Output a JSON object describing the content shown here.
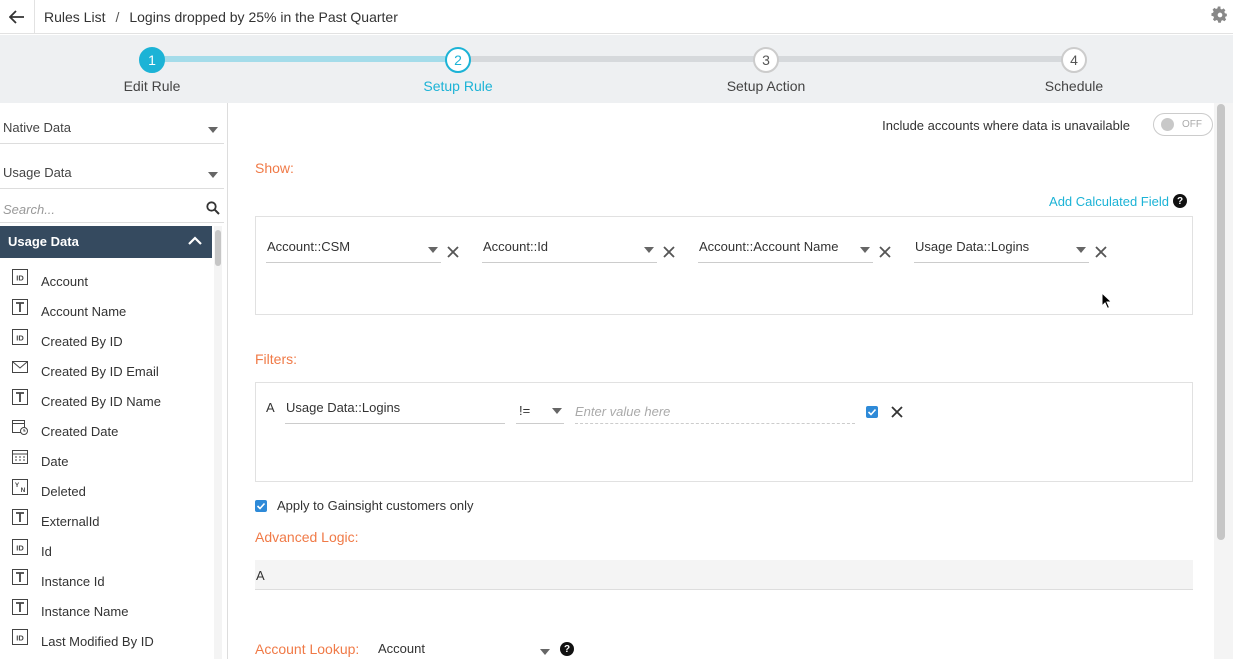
{
  "header": {
    "breadcrumb_root": "Rules List",
    "separator": "/",
    "title": "Logins dropped by 25% in the Past Quarter"
  },
  "stepper": {
    "steps": [
      {
        "number": "1",
        "label": "Edit Rule",
        "state": "done"
      },
      {
        "number": "2",
        "label": "Setup Rule",
        "state": "active"
      },
      {
        "number": "3",
        "label": "Setup Action",
        "state": "todo"
      },
      {
        "number": "4",
        "label": "Schedule",
        "state": "todo"
      }
    ]
  },
  "sidebar": {
    "source_select": "Native Data",
    "object_select": "Usage Data",
    "search_placeholder": "Search...",
    "group_title": "Usage Data",
    "fields": [
      {
        "icon": "id",
        "label": "Account"
      },
      {
        "icon": "text",
        "label": "Account Name"
      },
      {
        "icon": "id",
        "label": "Created By ID"
      },
      {
        "icon": "email",
        "label": "Created By ID Email"
      },
      {
        "icon": "text",
        "label": "Created By ID Name"
      },
      {
        "icon": "datetime",
        "label": "Created Date"
      },
      {
        "icon": "date",
        "label": "Date"
      },
      {
        "icon": "boolean",
        "label": "Deleted"
      },
      {
        "icon": "text",
        "label": "ExternalId"
      },
      {
        "icon": "id",
        "label": "Id"
      },
      {
        "icon": "text",
        "label": "Instance Id"
      },
      {
        "icon": "text",
        "label": "Instance Name"
      },
      {
        "icon": "id",
        "label": "Last Modified By ID"
      }
    ]
  },
  "main": {
    "include_label": "Include accounts where data is unavailable",
    "include_toggle": "OFF",
    "show_title": "Show:",
    "add_calculated_field": "Add Calculated Field",
    "help_glyph": "?",
    "show_columns": [
      "Account::CSM",
      "Account::Id",
      "Account::Account Name",
      "Usage Data::Logins"
    ],
    "filters_title": "Filters:",
    "filter": {
      "letter": "A",
      "field": "Usage Data::Logins",
      "operator": "!=",
      "value_placeholder": "Enter value here"
    },
    "apply_label": "Apply to Gainsight customers only",
    "advanced_logic_title": "Advanced Logic:",
    "advanced_logic_value": "A",
    "account_lookup_label": "Account Lookup:",
    "account_lookup_value": "Account"
  },
  "colors": {
    "accent": "#1cb3d6",
    "section_title": "#f07a47",
    "sidebar_group_bg": "#354a5f",
    "checkbox": "#2e8ad8"
  }
}
